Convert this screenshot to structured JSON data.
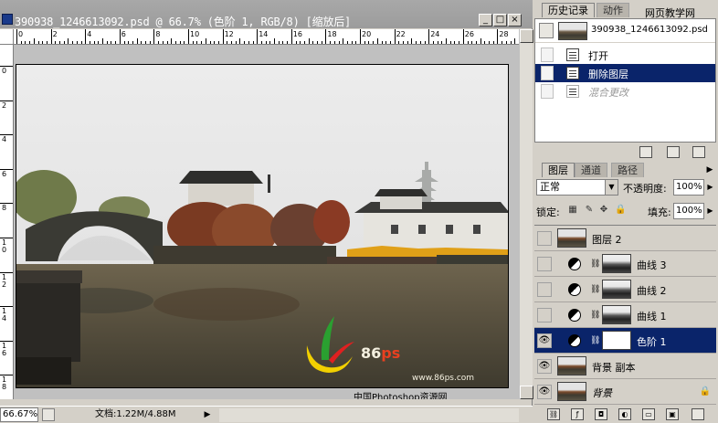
{
  "document": {
    "title": "390938_1246613092.psd @ 66.7% (色阶 1, RGB/8) [缩放后]",
    "zoom": "66.67%",
    "doc_size": "文档:1.22M/4.88M",
    "ruler_top_numbers": [
      "0",
      "2",
      "4",
      "6",
      "8",
      "10",
      "12",
      "14",
      "16",
      "18",
      "20",
      "22",
      "24",
      "26",
      "28"
    ],
    "ruler_left_numbers": [
      "0",
      "2",
      "4",
      "6",
      "8",
      "10",
      "12",
      "14",
      "16",
      "18"
    ],
    "watermark_site": "www.86ps.com",
    "watermark_brand": "86",
    "watermark_brand_ps": "ps",
    "watermark_caption": "中国Photoshop资源网"
  },
  "history_panel": {
    "tabs": [
      "历史记录",
      "动作"
    ],
    "header_watermark": "网页教学网",
    "snapshot_label": "390938_1246613092.psd",
    "steps": [
      {
        "label": "打开",
        "state": "normal"
      },
      {
        "label": "删除图层",
        "state": "selected"
      },
      {
        "label": "混合更改",
        "state": "dim"
      }
    ]
  },
  "layers_panel": {
    "tabs": [
      "图层",
      "通道",
      "路径"
    ],
    "blend_mode": "正常",
    "opacity_label": "不透明度:",
    "opacity_value": "100%",
    "lock_label": "锁定:",
    "fill_label": "填充:",
    "fill_value": "100%",
    "layers": [
      {
        "name": "图层 2",
        "visible": false,
        "kind": "pixel",
        "selected": false
      },
      {
        "name": "曲线 3",
        "visible": false,
        "kind": "adjustment",
        "selected": false
      },
      {
        "name": "曲线 2",
        "visible": false,
        "kind": "adjustment",
        "selected": false
      },
      {
        "name": "曲线 1",
        "visible": false,
        "kind": "adjustment",
        "selected": false
      },
      {
        "name": "色阶 1",
        "visible": true,
        "kind": "adjustment-levels",
        "selected": true
      },
      {
        "name": "背景 副本",
        "visible": true,
        "kind": "pixel",
        "selected": false
      },
      {
        "name": "背景",
        "visible": true,
        "kind": "background",
        "selected": false
      }
    ]
  },
  "colors": {
    "selection_blue": "#0a246a",
    "panel_gray": "#d4d0c8",
    "titlebar_gray": "#a0a0a0"
  }
}
